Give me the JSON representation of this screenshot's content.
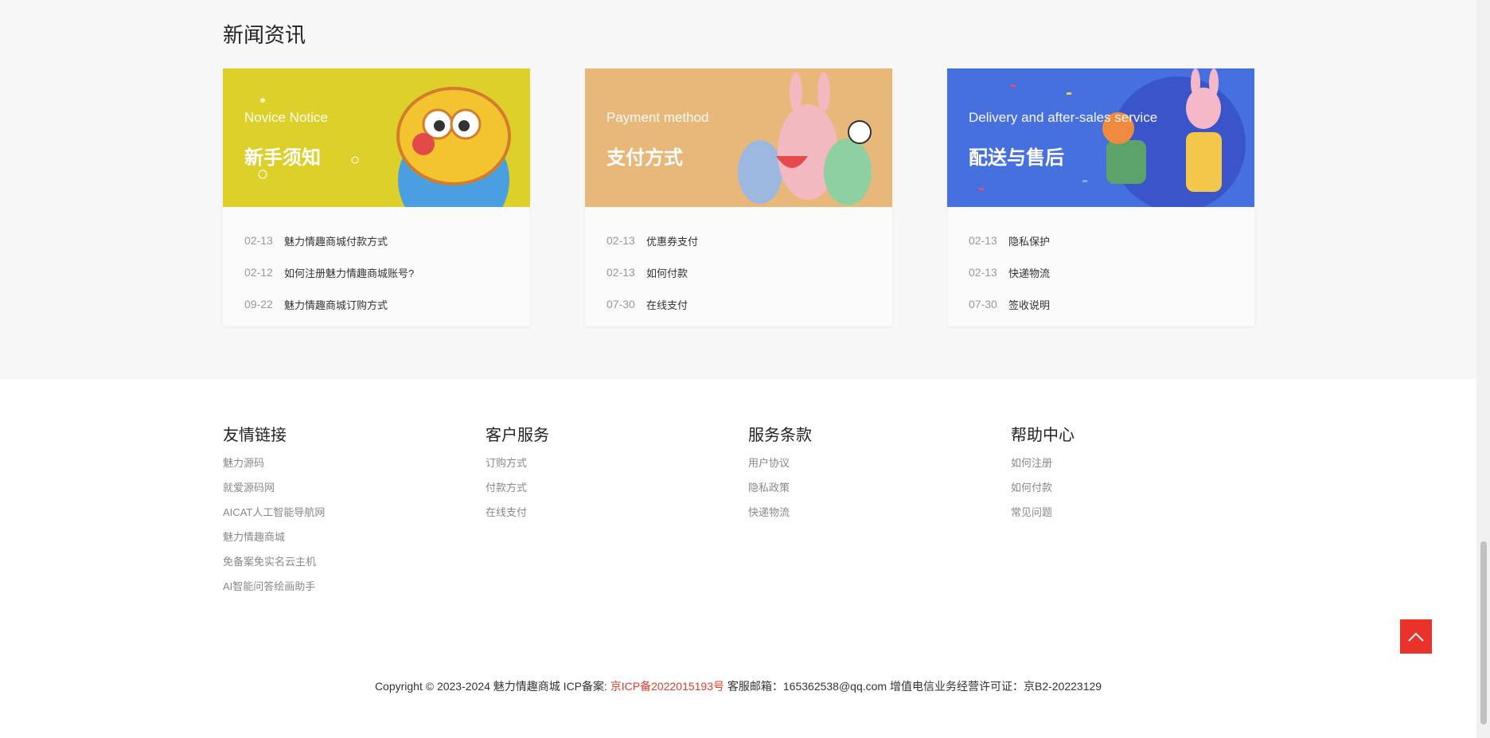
{
  "news": {
    "title": "新闻资讯",
    "cards": [
      {
        "en": "Novice Notice",
        "zh": "新手须知",
        "bg": "#ddd02a",
        "items": [
          {
            "date": "02-13",
            "title": "魅力情趣商城付款方式"
          },
          {
            "date": "02-12",
            "title": "如何注册魅力情趣商城账号?"
          },
          {
            "date": "09-22",
            "title": "魅力情趣商城订购方式"
          }
        ]
      },
      {
        "en": "Payment method",
        "zh": "支付方式",
        "bg": "#e8b87a",
        "items": [
          {
            "date": "02-13",
            "title": "优惠券支付"
          },
          {
            "date": "02-13",
            "title": "如何付款"
          },
          {
            "date": "07-30",
            "title": "在线支付"
          }
        ]
      },
      {
        "en": "Delivery and after-sales service",
        "zh": "配送与售后",
        "bg": "#4670dd",
        "items": [
          {
            "date": "02-13",
            "title": "隐私保护"
          },
          {
            "date": "02-13",
            "title": "快递物流"
          },
          {
            "date": "07-30",
            "title": "签收说明"
          }
        ]
      }
    ]
  },
  "footer": {
    "columns": [
      {
        "title": "友情链接",
        "links": [
          "魅力源码",
          "就爱源码网",
          "AICAT人工智能导航网",
          "魅力情趣商城",
          "免备案免实名云主机",
          "AI智能问答绘画助手"
        ]
      },
      {
        "title": "客户服务",
        "links": [
          "订购方式",
          "付款方式",
          "在线支付"
        ]
      },
      {
        "title": "服务条款",
        "links": [
          "用户协议",
          "隐私政策",
          "快递物流"
        ]
      },
      {
        "title": "帮助中心",
        "links": [
          "如何注册",
          "如何付款",
          "常见问题"
        ]
      }
    ],
    "copyright_prefix": "Copyright © 2023-2024 魅力情趣商城 ICP备案: ",
    "icp": "京ICP备2022015193号",
    "copyright_suffix": " 客服邮箱：165362538@qq.com 增值电信业务经营许可证：京B2-20223129"
  },
  "back_to_top_icon": "chevron-up-icon",
  "accent": "#e8322a"
}
